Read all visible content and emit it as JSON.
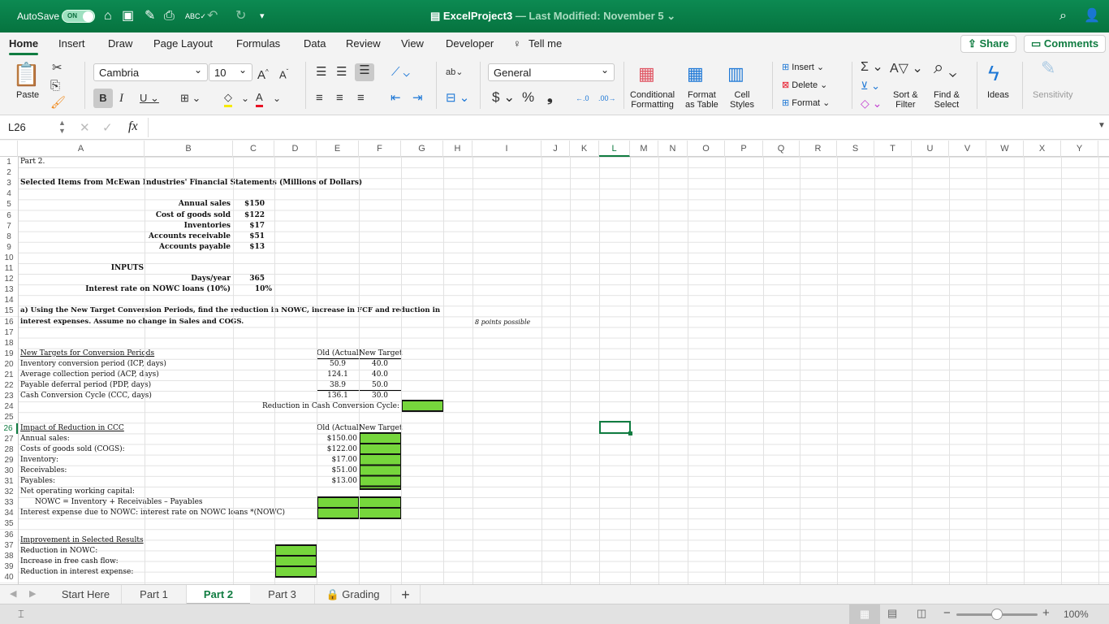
{
  "titlebar": {
    "autosave_label": "AutoSave",
    "autosave_state": "ON",
    "doc_title": "ExcelProject3",
    "modified": "— Last Modified: November 5"
  },
  "menu": {
    "tabs": [
      "Home",
      "Insert",
      "Draw",
      "Page Layout",
      "Formulas",
      "Data",
      "Review",
      "View",
      "Developer",
      "Tell me"
    ],
    "active": "Home",
    "share": "Share",
    "comments": "Comments"
  },
  "ribbon": {
    "paste": "Paste",
    "font_name": "Cambria",
    "font_size": "10",
    "number_format": "General",
    "conditional_formatting": [
      "Conditional",
      "Formatting"
    ],
    "format_as_table": [
      "Format",
      "as Table"
    ],
    "cell_styles": [
      "Cell",
      "Styles"
    ],
    "insert": "Insert",
    "delete": "Delete",
    "format": "Format",
    "sort_filter": [
      "Sort &",
      "Filter"
    ],
    "find_select": [
      "Find &",
      "Select"
    ],
    "ideas": "Ideas",
    "sensitivity": "Sensitivity"
  },
  "formula_bar": {
    "name_box": "L26",
    "fx": "fx",
    "formula": ""
  },
  "columns": [
    "A",
    "B",
    "C",
    "D",
    "E",
    "F",
    "G",
    "H",
    "I",
    "J",
    "K",
    "L",
    "M",
    "N",
    "O",
    "P",
    "Q",
    "R",
    "S",
    "T",
    "U",
    "V",
    "W",
    "X",
    "Y"
  ],
  "selected_column": "L",
  "selected_row": 26,
  "cells": {
    "r1": "Part 2.",
    "r3": "Selected Items from McEwan Industries' Financial Statements (Millions of Dollars)",
    "fin_labels": [
      "Annual sales",
      "Cost of goods sold",
      "Inventories",
      "Accounts receivable",
      "Accounts payable"
    ],
    "fin_values": [
      "$150",
      "$122",
      "$17",
      "$51",
      "$13"
    ],
    "inputs": "INPUTS",
    "days_label": "Days/year",
    "days_value": "365",
    "rate_label": "Interest rate on NOWC loans (10%)",
    "rate_value": "10%",
    "q_line1": "a) Using the New Target Conversion Periods, find the reduction in NOWC, increase in FCF and reduction in",
    "q_line2": "interest expenses. Assume no change in Sales and COGS.",
    "points": "8 points possible",
    "targets_header": "New Targets for Conversion Periods",
    "old_header": "Old (Actual)",
    "new_header": "New Target",
    "targets": [
      {
        "label": "Inventory conversion period (ICP, days)",
        "old": "50.9",
        "new": "40.0"
      },
      {
        "label": "Average collection period (ACP, days)",
        "old": "124.1",
        "new": "40.0"
      },
      {
        "label": "Payable deferral period (PDP, days)",
        "old": "38.9",
        "new": "50.0"
      },
      {
        "label": "Cash Conversion Cycle (CCC, days)",
        "old": "136.1",
        "new": "30.0"
      }
    ],
    "reduction_ccc": "Reduction in Cash Conversion Cycle:",
    "impact_header": "Impact of Reduction in CCC",
    "impact": [
      {
        "label": "Annual sales:",
        "old": "$150.00"
      },
      {
        "label": "Costs of goods sold (COGS):",
        "old": "$122.00"
      },
      {
        "label": "Inventory:",
        "old": "$17.00"
      },
      {
        "label": "Receivables:",
        "old": "$51.00"
      },
      {
        "label": "Payables:",
        "old": "$13.00"
      }
    ],
    "nowc_label": "Net operating working capital:",
    "nowc_formula": "NOWC = Inventory + Receivables – Payables",
    "interest_label": "Interest expense due to NOWC: interest rate on NOWC loans *(NOWC)",
    "improvement_header": "Improvement in Selected Results",
    "improvements": [
      "Reduction in NOWC:",
      "Increase in free cash flow:",
      "Reduction in interest expense:"
    ]
  },
  "sheets": {
    "tabs": [
      "Start Here",
      "Part 1",
      "Part 2",
      "Part 3",
      "Grading"
    ],
    "active": "Part 2"
  },
  "status": {
    "zoom": "100%",
    "zoom_level_fraction": 0.5
  }
}
